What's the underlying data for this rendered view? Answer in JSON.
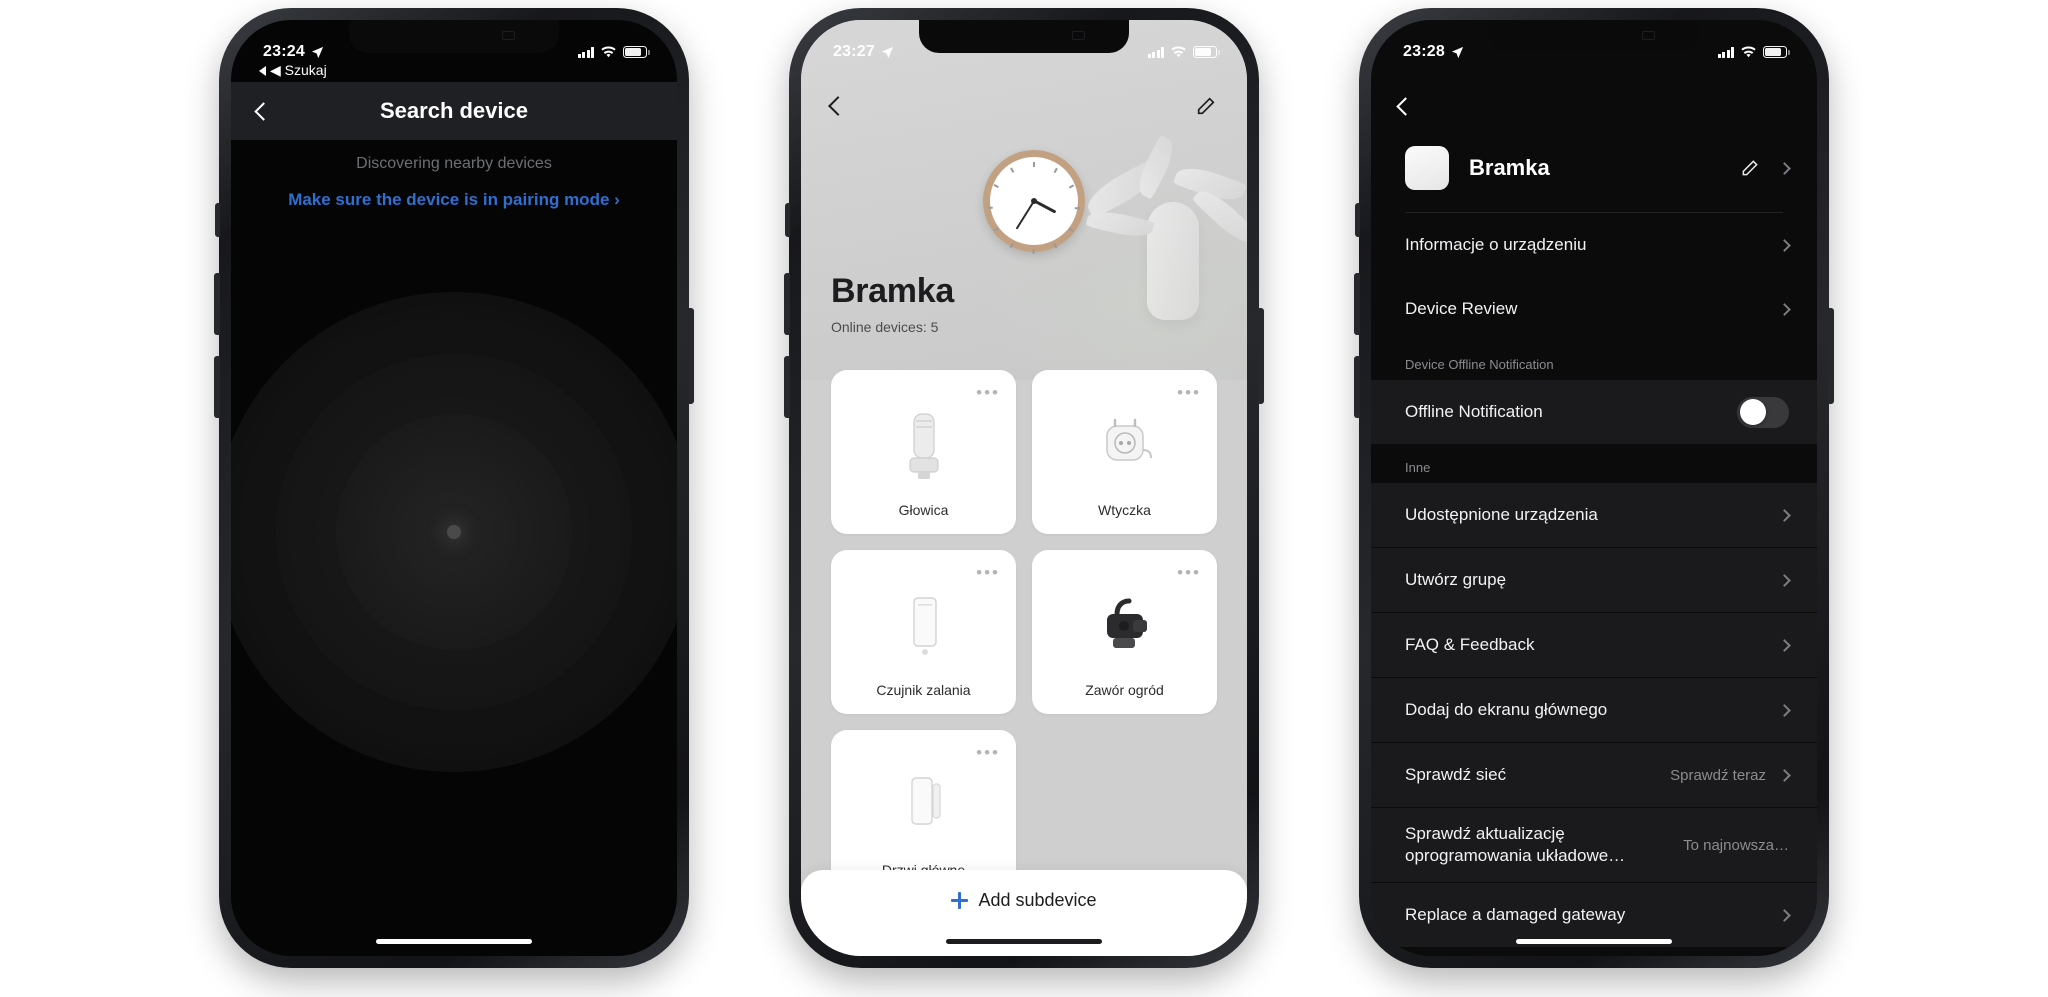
{
  "phones": [
    {
      "id": "search-device",
      "status_bar": {
        "time": "23:24",
        "back_label": "◀ Szukaj",
        "location_icon": "location-arrow-icon",
        "signal_icon": "cellular-signal-icon",
        "wifi_icon": "wifi-icon",
        "battery_icon": "battery-icon"
      },
      "nav": {
        "back_icon": "chevron-left-icon",
        "title": "Search device"
      },
      "subtitle": "Discovering nearby devices",
      "link": "Make sure the device is in pairing mode ›",
      "radar_icon": "radar-pulse-icon"
    },
    {
      "id": "gateway-devices",
      "status_bar": {
        "time": "23:27",
        "location_icon": "location-arrow-icon",
        "signal_icon": "cellular-signal-icon",
        "wifi_icon": "wifi-icon",
        "battery_icon": "battery-icon"
      },
      "nav": {
        "back_icon": "chevron-left-icon",
        "edit_icon": "pencil-icon"
      },
      "title": "Bramka",
      "online_devices": "Online devices: 5",
      "devices": [
        {
          "label": "Głowica",
          "icon": "thermostat-valve-icon",
          "menu_icon": "more-dots-icon"
        },
        {
          "label": "Wtyczka",
          "icon": "smart-plug-icon",
          "menu_icon": "more-dots-icon"
        },
        {
          "label": "Czujnik zalania",
          "icon": "water-leak-sensor-icon",
          "menu_icon": "more-dots-icon"
        },
        {
          "label": "Zawór ogród",
          "icon": "garden-valve-icon",
          "menu_icon": "more-dots-icon"
        },
        {
          "label": "Drzwi główne",
          "icon": "door-sensor-icon",
          "menu_icon": "more-dots-icon"
        }
      ],
      "add_subdevice": "Add subdevice",
      "add_icon": "plus-icon"
    },
    {
      "id": "gateway-settings",
      "status_bar": {
        "time": "23:28",
        "location_icon": "location-arrow-icon",
        "signal_icon": "cellular-signal-icon",
        "wifi_icon": "wifi-icon",
        "battery_icon": "battery-icon"
      },
      "nav": {
        "back_icon": "chevron-left-icon"
      },
      "device": {
        "name": "Bramka",
        "thumb_icon": "gateway-device-icon",
        "edit_icon": "pencil-icon",
        "chevron_icon": "chevron-right-icon"
      },
      "items_top": [
        {
          "label": "Informacje o urządzeniu",
          "value": "",
          "chevron_icon": "chevron-right-icon"
        },
        {
          "label": "Device Review",
          "value": "",
          "chevron_icon": "chevron-right-icon"
        }
      ],
      "section_offline": "Device Offline Notification",
      "offline_row": {
        "label": "Offline Notification",
        "toggle_state": "off",
        "toggle_icon": "toggle-switch-icon"
      },
      "section_other": "Inne",
      "items_other": [
        {
          "label": "Udostępnione urządzenia",
          "value": "",
          "chevron_icon": "chevron-right-icon"
        },
        {
          "label": "Utwórz grupę",
          "value": "",
          "chevron_icon": "chevron-right-icon"
        },
        {
          "label": "FAQ & Feedback",
          "value": "",
          "chevron_icon": "chevron-right-icon"
        },
        {
          "label": "Dodaj do ekranu głównego",
          "value": "",
          "chevron_icon": "chevron-right-icon"
        },
        {
          "label": "Sprawdź sieć",
          "value": "Sprawdź teraz",
          "chevron_icon": "chevron-right-icon"
        },
        {
          "label": "Sprawdź aktualizację oprogramowania układowe…",
          "value": "To najnowsza…",
          "chevron_icon": ""
        },
        {
          "label": "Replace a damaged gateway",
          "value": "",
          "chevron_icon": "chevron-right-icon"
        }
      ]
    }
  ],
  "colors": {
    "accent_blue": "#2f6fd0",
    "dark_bg": "#0b0b0c",
    "row_bg": "#1a1a1c",
    "light_bg": "#cfcfcf"
  }
}
